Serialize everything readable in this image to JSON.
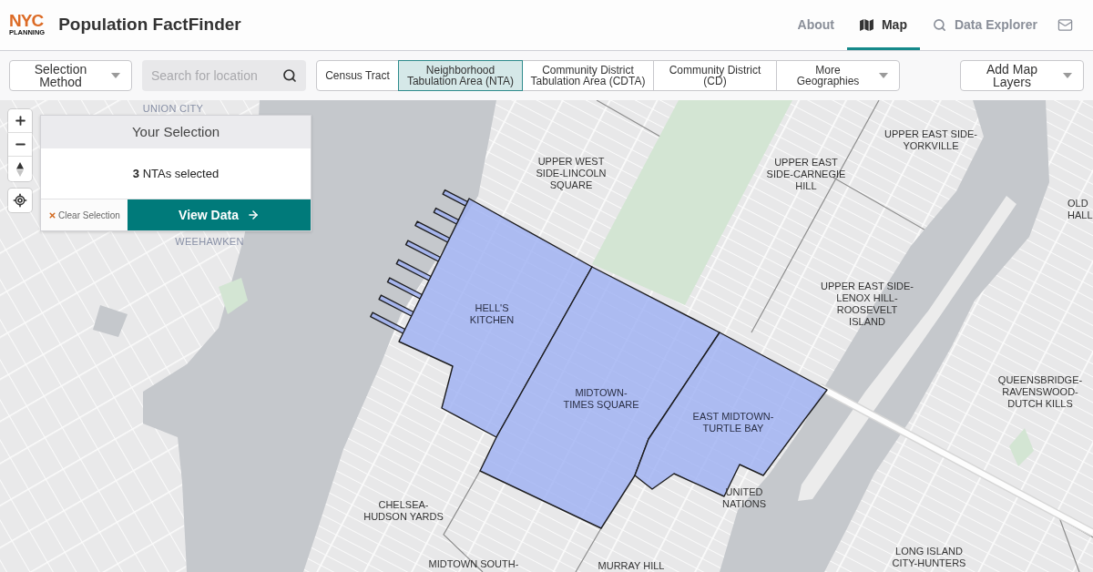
{
  "header": {
    "logo": {
      "top": "NYC",
      "bottom": "PLANNING"
    },
    "title": "Population FactFinder",
    "nav": [
      {
        "label": "About",
        "kind": "plain",
        "selected": false
      },
      {
        "label": "Map",
        "kind": "map",
        "selected": true
      },
      {
        "label": "Data Explorer",
        "kind": "search",
        "selected": false
      }
    ]
  },
  "toolbar": {
    "selection_method": {
      "lines": [
        "Selection",
        "Method"
      ]
    },
    "search": {
      "placeholder": "Search for location"
    },
    "geographies": [
      {
        "lines": [
          "Census Tract"
        ],
        "kind": "option",
        "selected": false
      },
      {
        "lines": [
          "Neighborhood",
          "Tabulation Area (NTA)"
        ],
        "kind": "option",
        "selected": true
      },
      {
        "lines": [
          "Community District",
          "Tabulation Area (CDTA)"
        ],
        "kind": "option",
        "selected": false
      },
      {
        "lines": [
          "Community District",
          "(CD)"
        ],
        "kind": "option",
        "selected": false
      },
      {
        "lines": [
          "More",
          "Geographies"
        ],
        "kind": "dropdown",
        "selected": false
      }
    ],
    "add_layers": {
      "lines": [
        "Add Map",
        "Layers"
      ]
    }
  },
  "map": {
    "selection_panel": {
      "title": "Your Selection",
      "summary": "**3** NTAs selected",
      "clear_button": "Clear Selection",
      "view_button": "View Data"
    },
    "place_labels": [
      {
        "kind": "town",
        "lines": [
          "UNION CITY"
        ]
      },
      {
        "kind": "neighborhood",
        "lines": [
          "UPPER EAST SIDE-",
          "YORKVILLE"
        ]
      },
      {
        "kind": "neighborhood",
        "lines": [
          "UPPER WEST",
          "SIDE-LINCOLN",
          "SQUARE"
        ]
      },
      {
        "kind": "neighborhood",
        "lines": [
          "UPPER EAST",
          "SIDE-CARNEGIE",
          "HILL"
        ]
      },
      {
        "kind": "neighborhood",
        "lines": [
          "OLD",
          "HALL"
        ]
      },
      {
        "kind": "town",
        "lines": [
          "WEEHAWKEN"
        ]
      },
      {
        "kind": "neighborhood",
        "lines": [
          "UPPER EAST SIDE-",
          "LENOX HILL-",
          "ROOSEVELT",
          "ISLAND"
        ]
      },
      {
        "kind": "neighborhood",
        "lines": [
          "QUEENSBRIDGE-",
          "RAVENSWOOD-",
          "DUTCH KILLS"
        ]
      },
      {
        "kind": "neighborhood",
        "lines": [
          "UNITED",
          "NATIONS"
        ]
      },
      {
        "kind": "neighborhood",
        "lines": [
          "CHELSEA-",
          "HUDSON YARDS"
        ]
      },
      {
        "kind": "neighborhood",
        "lines": [
          "MIDTOWN SOUTH-"
        ]
      },
      {
        "kind": "neighborhood",
        "lines": [
          "MURRAY HILL"
        ]
      },
      {
        "kind": "neighborhood",
        "lines": [
          "LONG ISLAND",
          "CITY-HUNTERS"
        ]
      }
    ],
    "selected_areas": [
      {
        "lines": [
          "HELL'S",
          "KITCHEN"
        ]
      },
      {
        "lines": [
          "MIDTOWN-",
          "TIMES SQUARE"
        ]
      },
      {
        "lines": [
          "EAST MIDTOWN-",
          "TURTLE BAY"
        ]
      }
    ]
  }
}
